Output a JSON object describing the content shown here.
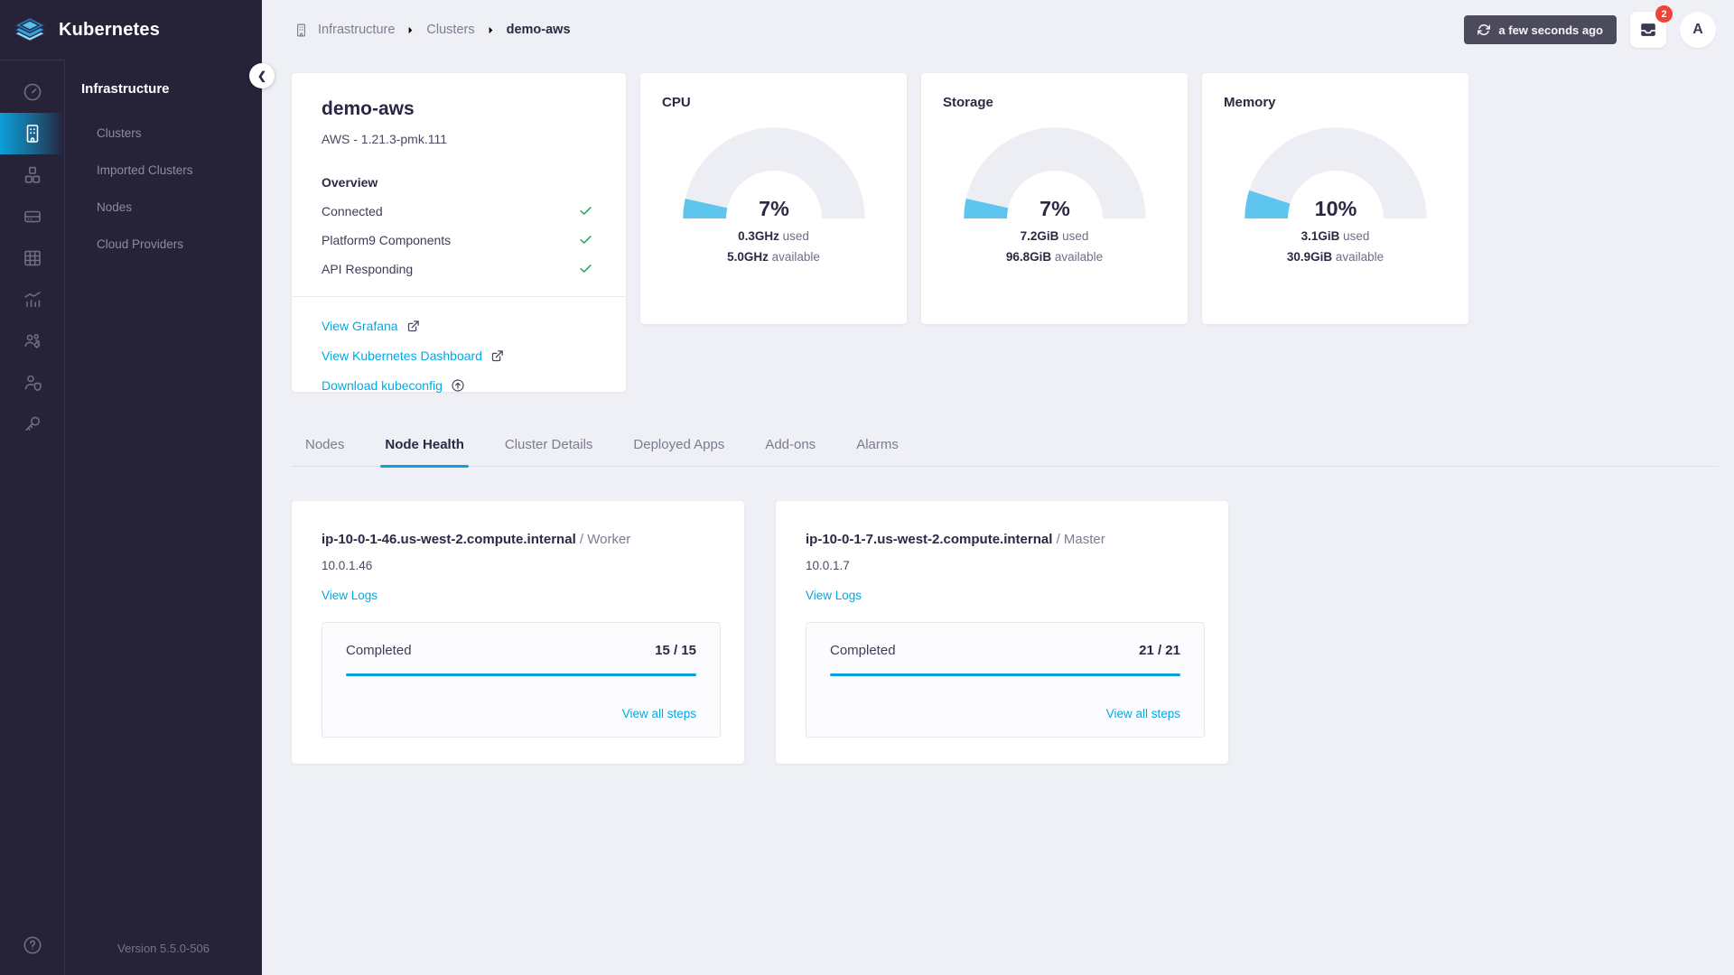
{
  "brand": {
    "title": "Kubernetes"
  },
  "sidebar": {
    "section": "Infrastructure",
    "rail": [
      {
        "icon": "gauge",
        "active": false
      },
      {
        "icon": "building",
        "active": true
      },
      {
        "icon": "cubes",
        "active": false
      },
      {
        "icon": "server",
        "active": false
      },
      {
        "icon": "grid",
        "active": false
      },
      {
        "icon": "bar-chart",
        "active": false
      },
      {
        "icon": "users-gear",
        "active": false
      },
      {
        "icon": "user-shield",
        "active": false
      },
      {
        "icon": "key",
        "active": false
      }
    ],
    "items": [
      {
        "label": "Clusters"
      },
      {
        "label": "Imported Clusters"
      },
      {
        "label": "Nodes"
      },
      {
        "label": "Cloud Providers"
      }
    ],
    "version": "Version 5.5.0-506"
  },
  "breadcrumb": [
    "Infrastructure",
    "Clusters",
    "demo-aws"
  ],
  "header": {
    "refresh_label": "a few seconds ago",
    "notification_count": "2",
    "avatar_initial": "A"
  },
  "cluster_card": {
    "title": "demo-aws",
    "subtitle": "AWS - 1.21.3-pmk.111",
    "overview_label": "Overview",
    "checks": [
      "Connected",
      "Platform9 Components",
      "API Responding"
    ],
    "links": [
      {
        "label": "View Grafana",
        "icon": "external-link"
      },
      {
        "label": "View Kubernetes Dashboard",
        "icon": "external-link"
      },
      {
        "label": "Download kubeconfig",
        "icon": "upload-circle"
      }
    ]
  },
  "chart_data": [
    {
      "type": "gauge",
      "title": "CPU",
      "percent": 7,
      "percent_label": "7%",
      "used_value": "0.3GHz",
      "used_label": "used",
      "available_value": "5.0GHz",
      "available_label": "available"
    },
    {
      "type": "gauge",
      "title": "Storage",
      "percent": 7,
      "percent_label": "7%",
      "used_value": "7.2GiB",
      "used_label": "used",
      "available_value": "96.8GiB",
      "available_label": "available"
    },
    {
      "type": "gauge",
      "title": "Memory",
      "percent": 10,
      "percent_label": "10%",
      "used_value": "3.1GiB",
      "used_label": "used",
      "available_value": "30.9GiB",
      "available_label": "available"
    }
  ],
  "tabs": {
    "active_index": 1,
    "items": [
      "Nodes",
      "Node Health",
      "Cluster Details",
      "Deployed Apps",
      "Add-ons",
      "Alarms"
    ]
  },
  "node_cards": [
    {
      "host": "ip-10-0-1-46.us-west-2.compute.internal",
      "role": "/ Worker",
      "ip": "10.0.1.46",
      "view_logs_label": "View Logs",
      "status_label": "Completed",
      "steps_label": "15 / 15",
      "view_all_label": "View all steps"
    },
    {
      "host": "ip-10-0-1-7.us-west-2.compute.internal",
      "role": "/ Master",
      "ip": "10.0.1.7",
      "view_logs_label": "View Logs",
      "status_label": "Completed",
      "steps_label": "21 / 21",
      "view_all_label": "View all steps"
    }
  ],
  "colors": {
    "accent": "#00a9e4",
    "progress": "#0ba1db",
    "gauge_fill": "#5ec6ee",
    "gauge_track": "#eceef4",
    "check_green": "#2ea661",
    "badge_red": "#ef4336",
    "sidebar_bg": "#262339"
  }
}
